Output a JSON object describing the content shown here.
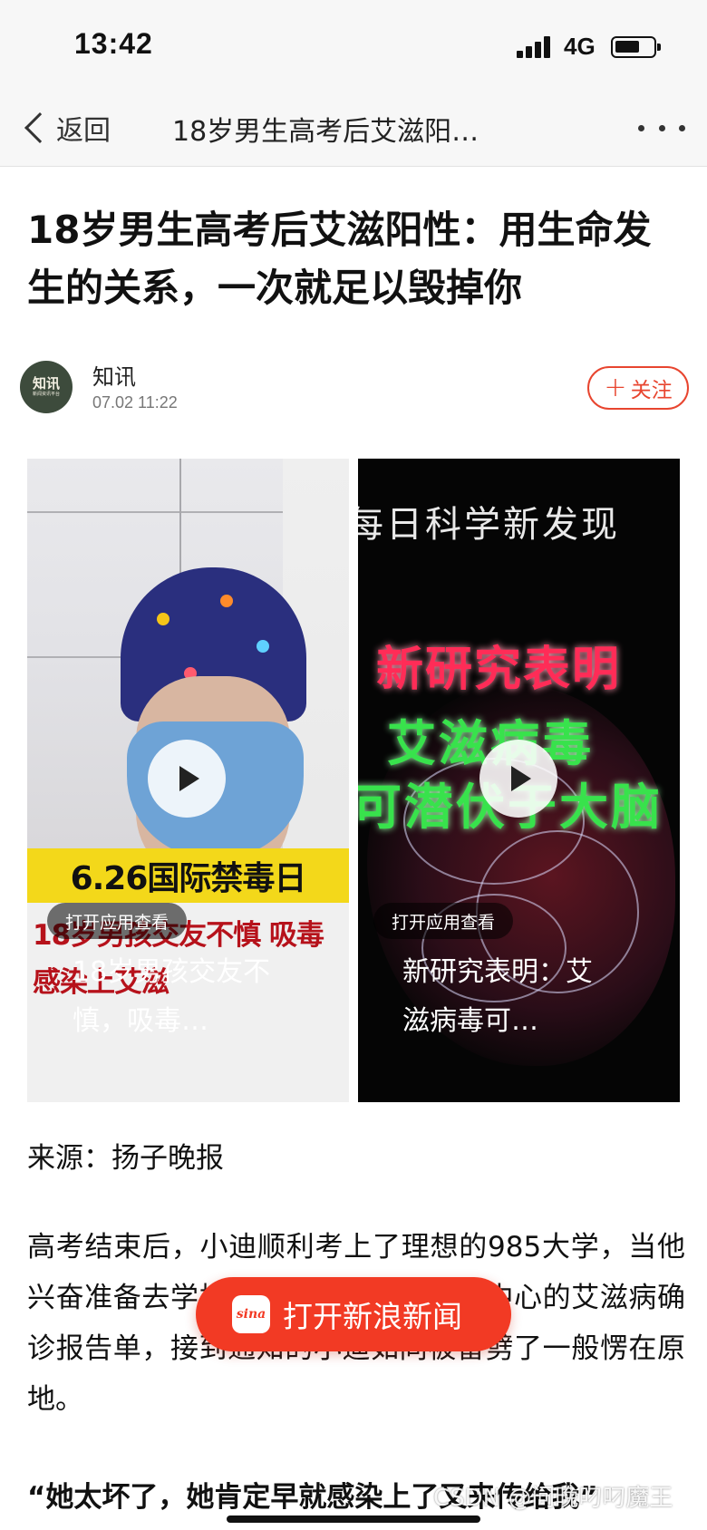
{
  "status_bar": {
    "time": "13:42",
    "network": "4G"
  },
  "nav": {
    "back_label": "返回",
    "title": "18岁男生高考后艾滋阳…"
  },
  "article": {
    "title": "18岁男生高考后艾滋阳性：用生命发生的关系，一次就足以毁掉你",
    "author": {
      "name": "知讯",
      "time": "07.02 11:22",
      "avatar_text": "知讯",
      "avatar_sub": "新闻资讯平台"
    },
    "follow_label": "关注",
    "source": "来源：扬子晚报",
    "body": "高考结束后，小迪顺利考上了理想的985大学，当他兴奋准备去学校报到时，接到了疾控中心的艾滋病确诊报告单，接到通知的小迪如同被雷劈了一般愣在原地。",
    "quote": "“她太坏了，她肯定早就感染上了又来传给我”"
  },
  "videos": [
    {
      "overlay_yellow": "6.26国际禁毒日",
      "overlay_red": "18岁男孩交友不慎 吸毒感染上艾滋",
      "open_app_label": "打开应用查看",
      "caption": "18岁男孩交友不慎，吸毒…"
    },
    {
      "header_text": "每日科学新发现",
      "neon_red": "新研究表明",
      "neon_green_1": "艾滋病毒",
      "neon_green_2": "可潜伏于大脑",
      "open_app_label": "打开应用查看",
      "caption": "新研究表明：艾滋病毒可…"
    }
  ],
  "cta": {
    "label": "打开新浪新闻",
    "logo_text": "sina"
  },
  "watermark": "CSDN @问晚叼叼魔王",
  "colors": {
    "accent": "#f23a24",
    "follow": "#e8452f"
  },
  "icons": [
    "back-chevron-icon",
    "more-dots-icon",
    "play-icon",
    "plus-icon",
    "signal-icon",
    "battery-icon"
  ]
}
